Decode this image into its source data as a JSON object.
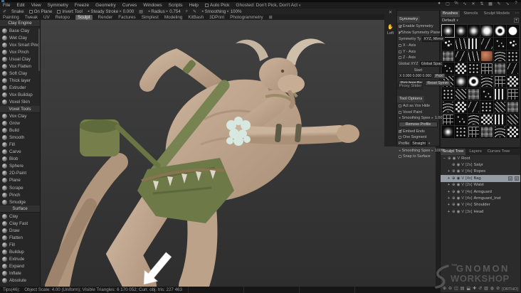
{
  "menu_bar": {
    "items": [
      "File",
      "Edit",
      "View",
      "Symmetry",
      "Freeze",
      "Geometry",
      "Curves",
      "Windows",
      "Scripts",
      "Help"
    ],
    "auto_pick_label": "Auto Pick",
    "ghosted_label": "Ghosted: Don't Pick, Don't Act"
  },
  "view_icons": [
    {
      "name": "circle-icon",
      "glyph": "●"
    },
    {
      "name": "square-icon",
      "glyph": "▢"
    },
    {
      "name": "percent-icon",
      "glyph": "%"
    },
    {
      "name": "curve-icon",
      "glyph": "∿"
    },
    {
      "name": "cross-icon",
      "glyph": "✕"
    },
    {
      "name": "swap-icon",
      "glyph": "⇅"
    },
    {
      "name": "grid-icon",
      "glyph": "▦"
    },
    {
      "name": "pen-icon",
      "glyph": "✎"
    },
    {
      "name": "arrow-icon",
      "glyph": "➘"
    },
    {
      "name": "help-icon",
      "glyph": "?"
    }
  ],
  "stroke_bar": {
    "snake_label": "Snake",
    "on_plane_label": "On Plane",
    "invert_tool_label": "Invert Tool",
    "steady_stroke_label": "Steady Stroke",
    "steady_stroke_value": "0.000",
    "radius_label": "Radius",
    "radius_value": "0.754",
    "smoothing_label": "Smoothing",
    "smoothing_value": "100%"
  },
  "rooms": {
    "tabs": [
      "Painting",
      "Tweak",
      "UV",
      "Retopo",
      "Sculpt",
      "Render",
      "Factures",
      "Simplest",
      "Modeling",
      "KitBash",
      "3DPrint",
      "Photogrammetry"
    ],
    "active": "Sculpt"
  },
  "tool_panel": {
    "sections": [
      {
        "title": "Clay Engine",
        "tools": [
          "Base Clay",
          "Wet Clay",
          "Vox Smart Pinch",
          "Vox Pinch",
          "Usual Clay",
          "Vox Flatten",
          "Soft Clay",
          "Thick layer",
          "Extruder",
          "Vox Buildup",
          "Voxel Skin"
        ]
      },
      {
        "title": "Voxel Tools",
        "tools": [
          "Vox Clay",
          "Grow",
          "Build",
          "Smooth",
          "Fill",
          "Carve",
          "Blob",
          "Sphere",
          "2D-Paint",
          "Plane",
          "Scrape",
          "Pinch",
          "Smudge"
        ]
      },
      {
        "title": "Surface",
        "tools": [
          "Clay",
          "Clay Fast",
          "Draw",
          "Flatten",
          "Fill",
          "Buildup",
          "Extrude",
          "Expand",
          "Inflate",
          "Absolute"
        ]
      }
    ]
  },
  "symmetry_panel": {
    "tab": "Symmetry",
    "close_glyph": "✕",
    "side_label": "Left",
    "enable_label": "Enable Symmetry",
    "show_plane_label": "Show Symmetry Plane",
    "type_label": "Symmetry Ty",
    "type_value": "XYZ, Mirror",
    "axes": [
      {
        "label": "X - Axis"
      },
      {
        "label": "Y - Axis"
      },
      {
        "label": "Z - Axis"
      }
    ],
    "global_label": "Global XYZ",
    "global_value": "Global Spac",
    "start_label": "Start",
    "coords_value": "X 0.000 0.000 0.000",
    "pick_button": "Pick!",
    "pick_from_button": "Pick from Bo",
    "reset_button": "Reset Symm"
  },
  "tool_options_panel": {
    "tab_proxy": "Proxy Slider",
    "tab_options": "Tool Options",
    "act_as_vox_hide": "Act as Vox Hide",
    "voxel_paint": "Voxel Paint",
    "smoothing1_label": "Smoothing Spee",
    "smoothing1_value": "1.00",
    "remove_profile": "Remove Profile",
    "embed_ends": "Embed Ends",
    "one_segment": "One Segment",
    "profile_label": "Profile",
    "profile_value": "Straight",
    "smoothing2_label": "Smoothing Spee",
    "smoothing2_value": "100%",
    "snap_to_surface": "Snap to Surface"
  },
  "brushes_panel": {
    "tabs": [
      "Brushes",
      "Stencils",
      "Sculpt Models"
    ],
    "active_tab": "Brushes",
    "more_glyph": "⋯",
    "preset": "Default",
    "add_glyph": "+",
    "cells": [
      "soft",
      "soft",
      "soft2",
      "softlg",
      "ring",
      "disc",
      "spatter",
      "squiggle",
      "stamps",
      "strokes",
      "specks",
      "spatter",
      "noise",
      "strokes",
      "squiggle",
      "ball",
      "waves",
      "dots",
      "specks",
      "checker",
      "dots",
      "grid",
      "noise",
      "strokes",
      "hatch",
      "soft2",
      "ring",
      "waves",
      "grid",
      "checker",
      "dots",
      "hatch",
      "noise",
      "specks",
      "stamps",
      "grid",
      "waves",
      "checker",
      "strokes",
      "dots",
      "hatch",
      "noise",
      "grid",
      "specks",
      "waves",
      "checker",
      "stamps",
      "hatch",
      "soft",
      "dots",
      "grid",
      "noise",
      "waves",
      "checker"
    ]
  },
  "sculpt_tree": {
    "tabs": [
      "Sculpt Tree",
      "Layers",
      "Curves Tree"
    ],
    "active_tab": "Sculpt Tree",
    "nodes": [
      {
        "expand": "−",
        "count": "",
        "name": "Root",
        "depth": 0,
        "selected": false
      },
      {
        "expand": "",
        "count": "[2x]",
        "name": "Satyr",
        "depth": 1,
        "selected": false
      },
      {
        "expand": "+",
        "count": "[4x]",
        "name": "Ropes",
        "depth": 1,
        "selected": false
      },
      {
        "expand": "+",
        "count": "[4x]",
        "name": "Bag",
        "depth": 1,
        "selected": true
      },
      {
        "expand": "+",
        "count": "[2x]",
        "name": "Waist",
        "depth": 1,
        "selected": false
      },
      {
        "expand": "+",
        "count": "[4x]",
        "name": "Armguard",
        "depth": 1,
        "selected": false
      },
      {
        "expand": "+",
        "count": "[4x]",
        "name": "Armguard_Inst",
        "depth": 1,
        "selected": false
      },
      {
        "expand": "+",
        "count": "[4x]",
        "name": "Shoulder",
        "depth": 1,
        "selected": false
      },
      {
        "expand": "+",
        "count": "[3x]",
        "name": "Head",
        "depth": 1,
        "selected": false
      }
    ],
    "toolbar_icons": [
      {
        "name": "add-volume-icon",
        "glyph": "⊕"
      },
      {
        "name": "remove-volume-icon",
        "glyph": "⊖"
      },
      {
        "name": "duplicate-icon",
        "glyph": "◫"
      },
      {
        "name": "folder-icon",
        "glyph": "▤"
      },
      {
        "name": "merge-icon",
        "glyph": "⬓"
      },
      {
        "name": "plus-icon",
        "glyph": "✚"
      },
      {
        "name": "undo-icon",
        "glyph": "↺"
      },
      {
        "name": "layers-icon",
        "glyph": "▥"
      },
      {
        "name": "ghost-icon",
        "glyph": "◍"
      },
      {
        "name": "delete-icon",
        "glyph": "⊘"
      }
    ]
  },
  "status_bar": {
    "tips": "Tips(46):",
    "info": "Object Scale: 4.00 (Uniform);  Visible Triangles: 6 170 052;  Curr. obj. tris: 227 463"
  },
  "viewport": {
    "ortho_label": "[ORTHO]"
  },
  "watermark": {
    "the": "THE",
    "line1": "GNOMON",
    "line2": "WORKSHOP"
  },
  "colors": {
    "viewport_bg": "#3a3a3a",
    "panel_bg": "#2b2b2b",
    "selection": "#959ca4",
    "skin": "#c1a78e",
    "cloth_green": "#6d7947",
    "fluff": "#d7e8e0"
  }
}
